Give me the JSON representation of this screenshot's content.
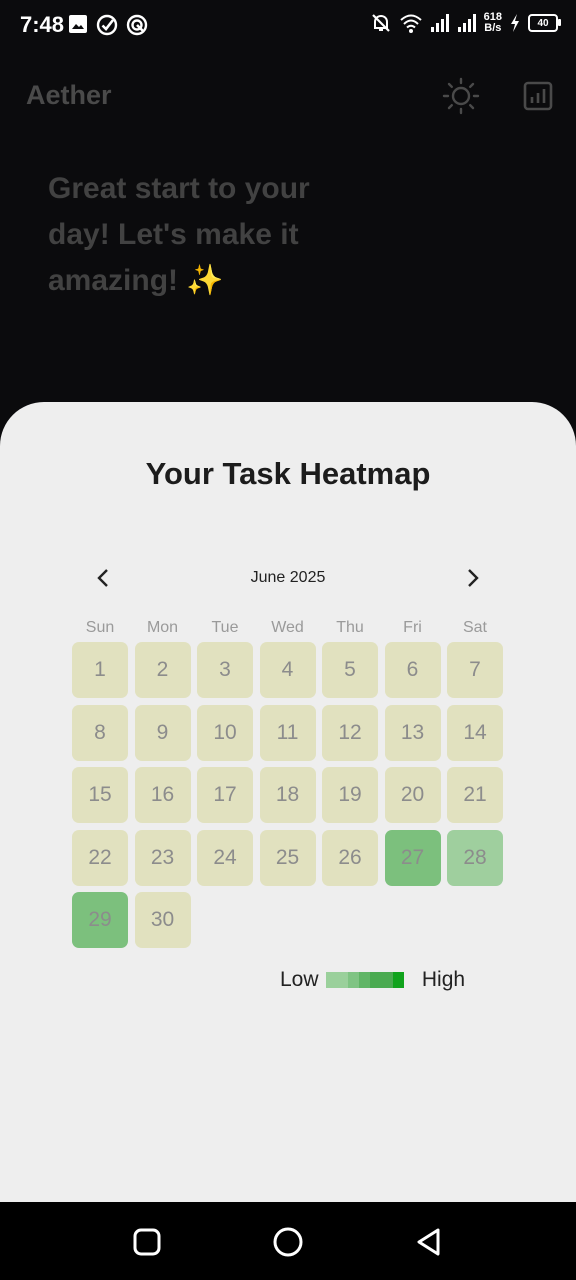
{
  "status_bar": {
    "time": "7:48",
    "net_speed_value": "618",
    "net_speed_unit": "B/s",
    "battery": "40",
    "left_icons": [
      "image-icon",
      "check-circle-icon",
      "sync-circle-icon"
    ],
    "right_icons": [
      "bell-off-icon",
      "wifi-icon",
      "signal-icon",
      "signal-icon",
      "charging-icon",
      "battery-icon"
    ]
  },
  "app_bar": {
    "title": "Aether",
    "theme_icon": "sun-icon",
    "stats_icon": "bar-chart-icon"
  },
  "greeting": "Great start to your day!  Let's make it amazing! ✨",
  "heatmap": {
    "title": "Your Task Heatmap",
    "month_label": "June 2025",
    "weekdays": [
      "Sun",
      "Mon",
      "Tue",
      "Wed",
      "Thu",
      "Fri",
      "Sat"
    ],
    "start_weekday_index": 0,
    "days": [
      {
        "day": "1",
        "level": 0
      },
      {
        "day": "2",
        "level": 0
      },
      {
        "day": "3",
        "level": 0
      },
      {
        "day": "4",
        "level": 0
      },
      {
        "day": "5",
        "level": 0
      },
      {
        "day": "6",
        "level": 0
      },
      {
        "day": "7",
        "level": 0
      },
      {
        "day": "8",
        "level": 0
      },
      {
        "day": "9",
        "level": 0
      },
      {
        "day": "10",
        "level": 0
      },
      {
        "day": "11",
        "level": 0
      },
      {
        "day": "12",
        "level": 0
      },
      {
        "day": "13",
        "level": 0
      },
      {
        "day": "14",
        "level": 0
      },
      {
        "day": "15",
        "level": 0
      },
      {
        "day": "16",
        "level": 0
      },
      {
        "day": "17",
        "level": 0
      },
      {
        "day": "18",
        "level": 0
      },
      {
        "day": "19",
        "level": 0
      },
      {
        "day": "20",
        "level": 0
      },
      {
        "day": "21",
        "level": 0
      },
      {
        "day": "22",
        "level": 0
      },
      {
        "day": "23",
        "level": 0
      },
      {
        "day": "24",
        "level": 0
      },
      {
        "day": "25",
        "level": 0
      },
      {
        "day": "26",
        "level": 0
      },
      {
        "day": "27",
        "level": 2
      },
      {
        "day": "28",
        "level": 1
      },
      {
        "day": "29",
        "level": 2
      },
      {
        "day": "30",
        "level": 0
      }
    ],
    "level_colors": [
      "#e1e1bf",
      "#9fcf9e",
      "#7cc07d"
    ],
    "legend": {
      "low_label": "Low",
      "high_label": "High",
      "colors": [
        "#9ad09b",
        "#7fc483",
        "#60b566",
        "#4aaa50",
        "#11a31d"
      ],
      "weights": [
        32,
        16,
        16,
        32,
        16
      ]
    }
  },
  "nav_bar": {
    "icons": [
      "recents-icon",
      "home-icon",
      "back-icon"
    ]
  }
}
